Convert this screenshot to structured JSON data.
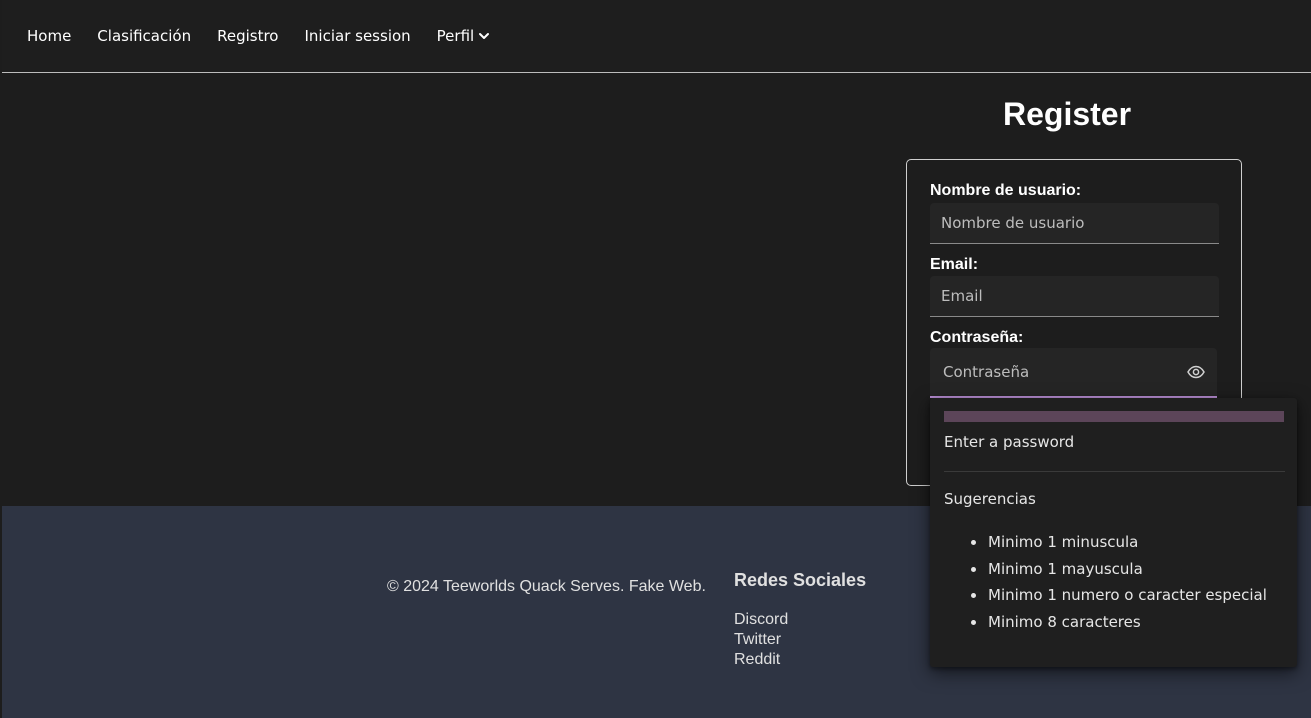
{
  "nav": {
    "items": [
      {
        "label": "Home"
      },
      {
        "label": "Clasificación"
      },
      {
        "label": "Registro"
      },
      {
        "label": "Iniciar session"
      }
    ],
    "profile_label": "Perfil",
    "profile_icon": "chevron-down-icon"
  },
  "register": {
    "title": "Register",
    "username": {
      "label": "Nombre de usuario:",
      "placeholder": "Nombre de usuario",
      "value": ""
    },
    "email": {
      "label": "Email:",
      "placeholder": "Email",
      "value": ""
    },
    "password": {
      "label": "Contraseña:",
      "placeholder": "Contraseña",
      "value": "",
      "toggle_icon": "eye-icon"
    }
  },
  "password_popover": {
    "strength_text": "Enter a password",
    "suggestions_title": "Sugerencias",
    "suggestions": [
      "Minimo 1 minuscula",
      "Minimo 1 mayuscula",
      "Minimo 1 numero o caracter especial",
      "Minimo 8 caracteres"
    ]
  },
  "footer": {
    "copyright": "© 2024 Teeworlds Quack Serves. Fake Web.",
    "social_title": "Redes Sociales",
    "social_links": [
      "Discord",
      "Twitter",
      "Reddit"
    ]
  },
  "colors": {
    "nav_bg": "#1e1e1e",
    "page_bg": "#1d1d1d",
    "footer_bg": "#2e3443",
    "focus_accent": "#ba8fd6",
    "strength_bar": "#5c4559"
  }
}
